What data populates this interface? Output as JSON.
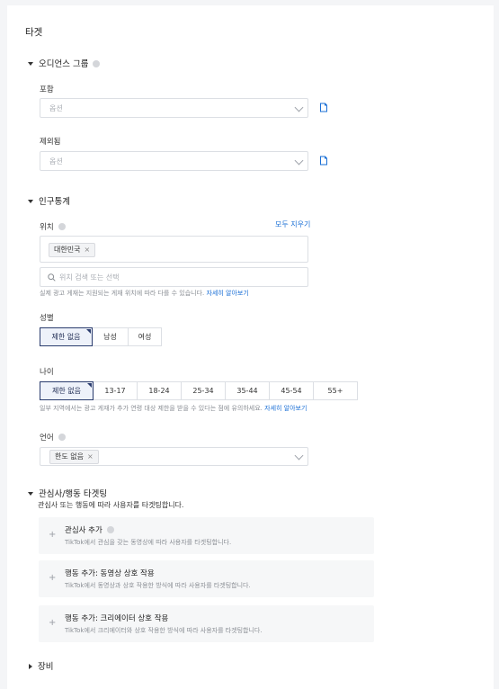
{
  "page": {
    "title": "타겟"
  },
  "audience": {
    "section_label": "오디언스 그룹",
    "include": {
      "label": "포함",
      "placeholder": "옵션"
    },
    "exclude": {
      "label": "제외됨",
      "placeholder": "옵션"
    }
  },
  "demographics": {
    "section_label": "인구통계",
    "location": {
      "label": "위치",
      "clear_all": "모두 지우기",
      "tags": [
        "대한민국"
      ],
      "search_placeholder": "위치 검색 또는 선택",
      "hint": "실제 광고 게재는 지원되는 게재 위치에 따라 다를 수 있습니다.",
      "hint_link": "자세히 알아보기"
    },
    "gender": {
      "label": "성별",
      "options": [
        "제한 없음",
        "남성",
        "여성"
      ],
      "selected": "제한 없음"
    },
    "age": {
      "label": "나이",
      "options": [
        "제한 없음",
        "13-17",
        "18-24",
        "25-34",
        "35-44",
        "45-54",
        "55+"
      ],
      "selected": "제한 없음",
      "hint": "일부 지역에서는 광고 게재가 추가 연령 대상 제한을 받을 수 있다는 점에 유의하세요.",
      "hint_link": "자세히 알아보기"
    },
    "language": {
      "label": "언어",
      "tags": [
        "한도 없음"
      ]
    }
  },
  "interest": {
    "section_label": "관심사/행동 타겟팅",
    "description": "관심사 또는 행동에 따라 사용자를 타겟팅합니다.",
    "cards": [
      {
        "title": "관심사 추가",
        "desc": "TikTok에서 관심을 갖는 동영상에 따라 사용자를 타겟팅합니다."
      },
      {
        "title": "행동 추가: 동영상 상호 작용",
        "desc": "TikTok에서 동영상과 상호 작용한 방식에 따라 사용자를 타겟팅합니다."
      },
      {
        "title": "행동 추가: 크리에이터 상호 작용",
        "desc": "TikTok에서 크리에이터와 상호 작용한 방식에 따라 사용자를 타겟팅합니다."
      }
    ]
  },
  "device": {
    "section_label": "장비"
  },
  "colors": {
    "accent": "#2a3c6e",
    "link": "#1a6fd6"
  }
}
